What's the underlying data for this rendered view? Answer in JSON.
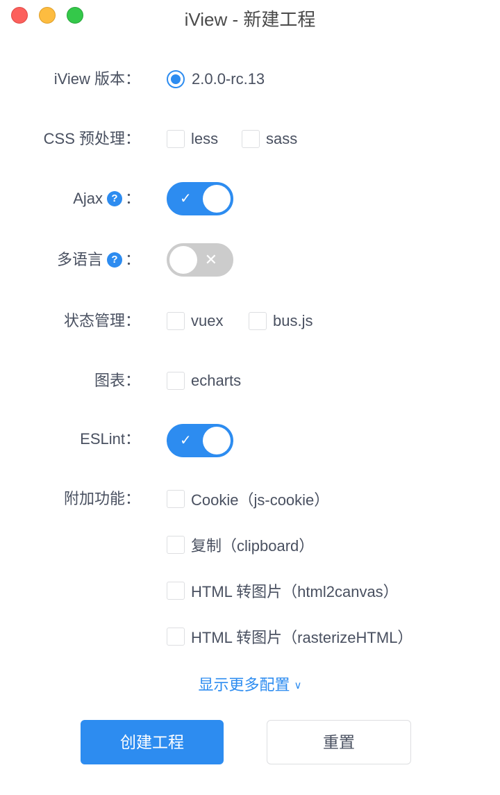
{
  "window": {
    "title": "iView - 新建工程"
  },
  "form": {
    "version": {
      "label": "iView 版本：",
      "option": "2.0.0-rc.13",
      "selected": true
    },
    "css": {
      "label": "CSS 预处理：",
      "options": [
        {
          "label": "less",
          "checked": false
        },
        {
          "label": "sass",
          "checked": false
        }
      ]
    },
    "ajax": {
      "label": "Ajax",
      "colon": "：",
      "help": "?",
      "enabled": true,
      "on_glyph": "✓"
    },
    "i18n": {
      "label": "多语言",
      "colon": "：",
      "help": "?",
      "enabled": false,
      "off_glyph": "✕"
    },
    "state": {
      "label": "状态管理：",
      "options": [
        {
          "label": "vuex",
          "checked": false
        },
        {
          "label": "bus.js",
          "checked": false
        }
      ]
    },
    "chart": {
      "label": "图表：",
      "options": [
        {
          "label": "echarts",
          "checked": false
        }
      ]
    },
    "eslint": {
      "label": "ESLint：",
      "enabled": true,
      "on_glyph": "✓"
    },
    "extras": {
      "label": "附加功能：",
      "options": [
        {
          "label": "Cookie（js-cookie）",
          "checked": false
        },
        {
          "label": "复制（clipboard）",
          "checked": false
        },
        {
          "label": "HTML 转图片（html2canvas）",
          "checked": false
        },
        {
          "label": "HTML 转图片（rasterizeHTML）",
          "checked": false
        }
      ]
    }
  },
  "more_link": {
    "label": "显示更多配置",
    "icon": "chevron-down-icon",
    "glyph": "∨"
  },
  "buttons": {
    "create": "创建工程",
    "reset": "重置"
  },
  "colors": {
    "accent": "#2d8cf0",
    "text": "#495060",
    "switch_off": "#cccccc",
    "border": "#dddee1"
  }
}
